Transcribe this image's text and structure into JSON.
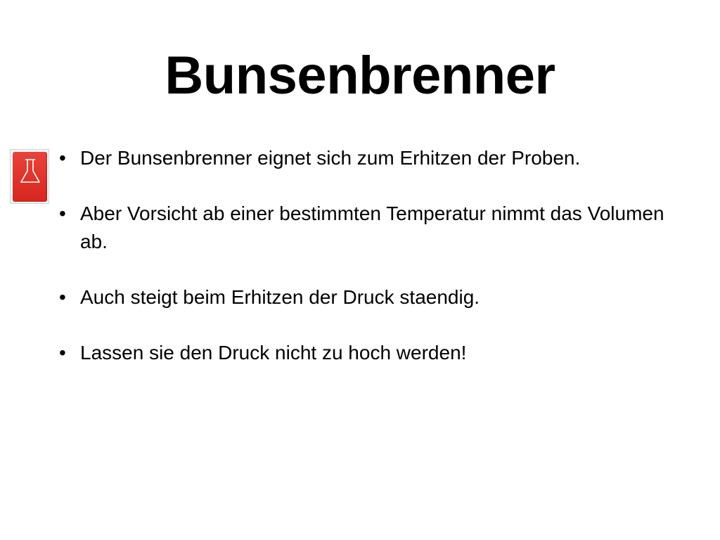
{
  "slide": {
    "title": "Bunsenbrenner",
    "bullet_symbol": "•",
    "bullets": [
      "Der Bunsenbrenner eignet sich zum Erhitzen der Proben.",
      "Aber Vorsicht ab einer bestimmten Temperatur nimmt das Volumen ab.",
      "Auch steigt beim Erhitzen der Druck staendig.",
      "Lassen sie den Druck nicht zu hoch werden!"
    ],
    "icon": {
      "name": "flask-icon",
      "color": "#dc2e25"
    }
  }
}
